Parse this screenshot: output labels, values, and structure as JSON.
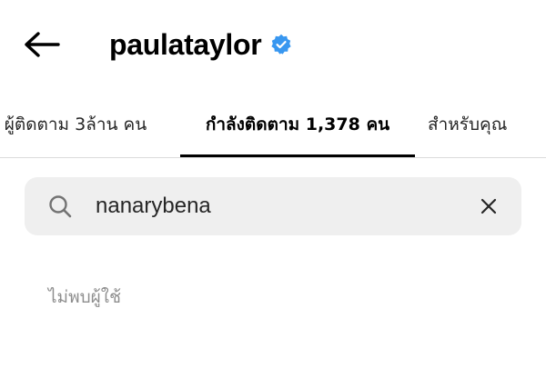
{
  "header": {
    "username": "paulataylor",
    "verified_color": "#3897f0",
    "back_icon": "arrow-left-icon",
    "verified_icon": "verified-badge-icon"
  },
  "tabs": {
    "followers": "ผู้ติดตาม 3ล้าน คน",
    "following": "กำลังติดตาม 1,378 คน",
    "for_you": "สำหรับคุณ",
    "active": "following"
  },
  "search": {
    "value": "nanarybena",
    "search_icon": "search-icon",
    "clear_icon": "close-icon"
  },
  "results": {
    "empty_message": "ไม่พบผู้ใช้"
  }
}
